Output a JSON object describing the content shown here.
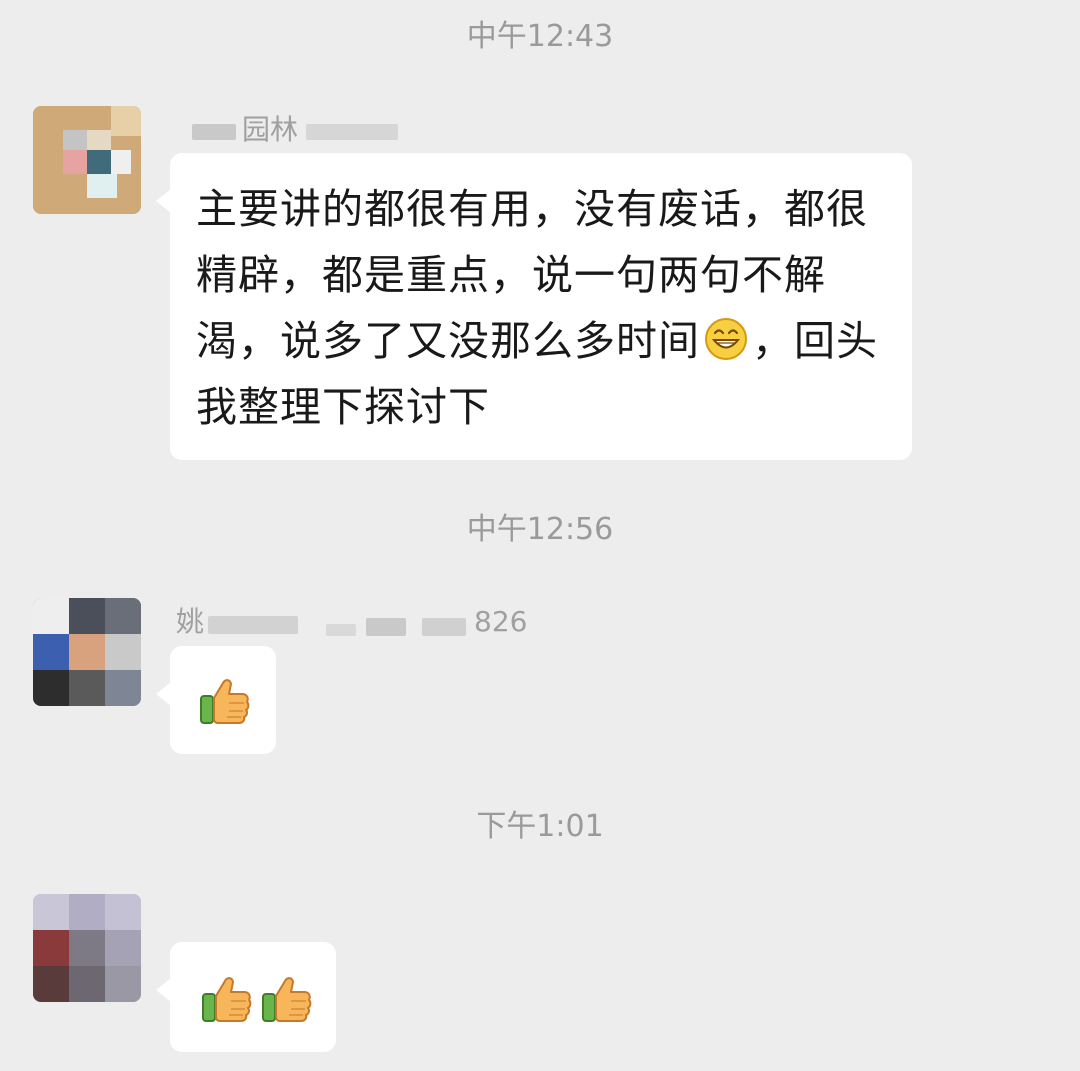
{
  "chat": {
    "messages": [
      {
        "time": "中午12:43",
        "sender": "园林",
        "text_before": "主要讲的都很有用，没有废话，都很精辟，都是重点，说一句两句不解渴，说多了又没那么多时间",
        "emoji": "grin-emoji",
        "text_after": "，回头我整理下探讨下"
      },
      {
        "time": "中午12:56",
        "sender": "姚",
        "sender_tail": "826",
        "emojis": [
          "thumbs-up-icon"
        ]
      },
      {
        "time": "下午1:01",
        "emojis": [
          "thumbs-up-icon",
          "thumbs-up-icon"
        ]
      }
    ]
  },
  "colors": {
    "background": "#ededed",
    "bubble": "#ffffff",
    "timestamp": "#9a9a9a",
    "sender": "#a0a0a0",
    "text": "#191919"
  }
}
